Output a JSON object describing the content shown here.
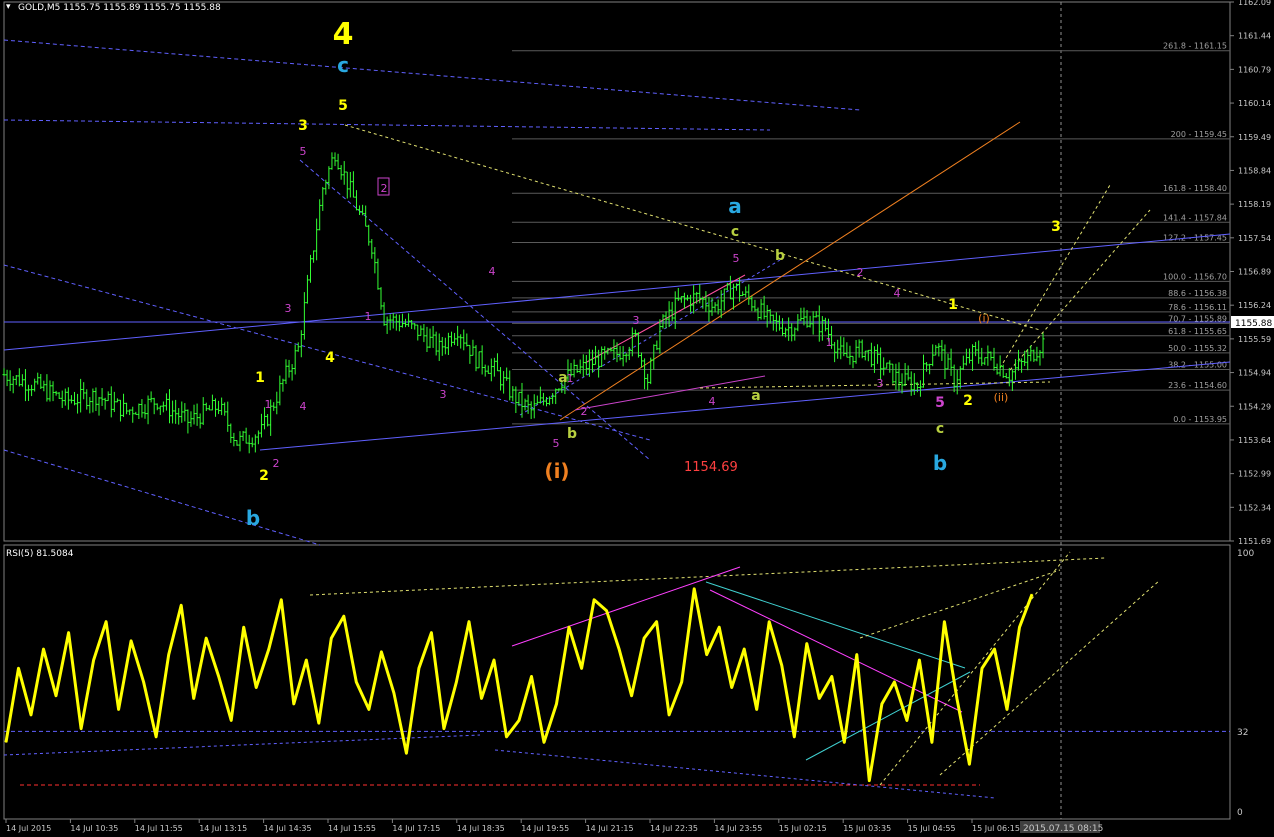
{
  "colors": {
    "background": "#000000",
    "candle": "#33ff33",
    "rsi_line": "#ffff00",
    "axis_text": "#c8c8c8",
    "fib_line": "#5a5a5a",
    "wave_yellow": "#ffff00",
    "wave_cyan": "#29a8e0",
    "wave_magenta": "#cc44cc",
    "wave_green": "#b8d040",
    "wave_orange": "#f08020",
    "trend_blue": "#6060ff",
    "red_level": "#ff3030"
  },
  "main_panel": {
    "header": "GOLD,M5  1155.75 1155.89 1155.75 1155.88",
    "current_price": "1155.88",
    "annotation_price": "1154.69"
  },
  "rsi_panel": {
    "header": "RSI(5) 81.5084",
    "levels": [
      "100",
      "32",
      "0"
    ]
  },
  "time_badge": "2015.07.15 08:15",
  "chart_data": [
    {
      "type": "candlestick",
      "title": "GOLD,M5",
      "ylim": [
        1151.69,
        1162.09
      ],
      "y_ticks": [
        "1162.09",
        "1161.44",
        "1160.79",
        "1160.14",
        "1159.49",
        "1158.84",
        "1158.19",
        "1157.54",
        "1156.89",
        "1156.24",
        "1155.59",
        "1154.94",
        "1154.29",
        "1153.64",
        "1152.99",
        "1152.34",
        "1151.69"
      ],
      "x_ticks": [
        "14 Jul 2015",
        "14 Jul 10:35",
        "14 Jul 11:55",
        "14 Jul 13:15",
        "14 Jul 14:35",
        "14 Jul 15:55",
        "14 Jul 17:15",
        "14 Jul 18:35",
        "14 Jul 19:55",
        "14 Jul 21:15",
        "14 Jul 22:35",
        "14 Jul 23:55",
        "15 Jul 02:15",
        "15 Jul 03:35",
        "15 Jul 04:55",
        "15 Jul 06:15"
      ],
      "close_path": [
        [
          0,
          1154.9
        ],
        [
          5,
          1154.7
        ],
        [
          10,
          1154.4
        ],
        [
          15,
          1154.5
        ],
        [
          20,
          1154.2
        ],
        [
          25,
          1154.4
        ],
        [
          30,
          1154.0
        ],
        [
          35,
          1154.3
        ],
        [
          38,
          1153.6
        ],
        [
          42,
          1153.8
        ],
        [
          46,
          1154.9
        ],
        [
          48,
          1155.4
        ],
        [
          50,
          1157.0
        ],
        [
          52,
          1158.5
        ],
        [
          54,
          1159.2
        ],
        [
          56,
          1158.6
        ],
        [
          58,
          1158.0
        ],
        [
          60,
          1157.4
        ],
        [
          62,
          1156.0
        ],
        [
          65,
          1155.9
        ],
        [
          68,
          1155.7
        ],
        [
          71,
          1155.4
        ],
        [
          74,
          1155.8
        ],
        [
          77,
          1155.2
        ],
        [
          80,
          1155.0
        ],
        [
          83,
          1154.5
        ],
        [
          86,
          1154.2
        ],
        [
          88,
          1154.4
        ],
        [
          91,
          1154.8
        ],
        [
          94,
          1155.0
        ],
        [
          97,
          1155.2
        ],
        [
          100,
          1155.3
        ],
        [
          103,
          1155.6
        ],
        [
          105,
          1154.8
        ],
        [
          107,
          1155.8
        ],
        [
          110,
          1156.3
        ],
        [
          113,
          1156.4
        ],
        [
          116,
          1156.2
        ],
        [
          119,
          1156.6
        ],
        [
          122,
          1156.3
        ],
        [
          125,
          1155.9
        ],
        [
          128,
          1155.8
        ],
        [
          131,
          1156.0
        ],
        [
          134,
          1155.8
        ],
        [
          137,
          1155.2
        ],
        [
          140,
          1155.4
        ],
        [
          143,
          1155.1
        ],
        [
          146,
          1154.8
        ],
        [
          149,
          1154.7
        ],
        [
          152,
          1155.5
        ],
        [
          155,
          1154.8
        ],
        [
          158,
          1155.3
        ],
        [
          161,
          1155.2
        ],
        [
          164,
          1154.9
        ],
        [
          167,
          1155.2
        ],
        [
          170,
          1155.6
        ]
      ],
      "fibonacci_levels": [
        {
          "label": "261.8 - 1161.15",
          "value": 1161.15
        },
        {
          "label": "200 - 1159.45",
          "value": 1159.45
        },
        {
          "label": "161.8 - 1158.40",
          "value": 1158.4
        },
        {
          "label": "141.4 - 1157.84",
          "value": 1157.84
        },
        {
          "label": "127.2 - 1157.45",
          "value": 1157.45
        },
        {
          "label": "100.0 - 1156.70",
          "value": 1156.7
        },
        {
          "label": "88.6 - 1156.38",
          "value": 1156.38
        },
        {
          "label": "78.6 - 1156.11",
          "value": 1156.11
        },
        {
          "label": "70.7 - 1155.89",
          "value": 1155.89
        },
        {
          "label": "61.8 - 1155.65",
          "value": 1155.65
        },
        {
          "label": "50.0 - 1155.32",
          "value": 1155.32
        },
        {
          "label": "38.2 - 1155.00",
          "value": 1155.0
        },
        {
          "label": "23.6 - 1154.60",
          "value": 1154.6
        },
        {
          "label": "0.0 - 1153.95",
          "value": 1153.95
        }
      ],
      "wave_labels": [
        {
          "text": "4",
          "color": "wave_yellow",
          "size": "xl"
        },
        {
          "text": "c",
          "color": "wave_cyan",
          "size": "lg"
        },
        {
          "text": "5",
          "color": "wave_yellow",
          "size": "md"
        },
        {
          "text": "3",
          "color": "wave_yellow",
          "size": "md"
        },
        {
          "text": "5",
          "color": "wave_magenta",
          "size": "sm"
        },
        {
          "text": "2",
          "color": "wave_magenta",
          "size": "sm"
        },
        {
          "text": "4",
          "color": "wave_magenta",
          "size": "sm"
        },
        {
          "text": "3",
          "color": "wave_magenta",
          "size": "sm"
        },
        {
          "text": "1",
          "color": "wave_magenta",
          "size": "sm"
        },
        {
          "text": "4",
          "color": "wave_yellow",
          "size": "md"
        },
        {
          "text": "3",
          "color": "wave_magenta",
          "size": "sm"
        },
        {
          "text": "1",
          "color": "wave_yellow",
          "size": "md"
        },
        {
          "text": "1",
          "color": "wave_magenta",
          "size": "sm"
        },
        {
          "text": "4",
          "color": "wave_magenta",
          "size": "sm"
        },
        {
          "text": "2",
          "color": "wave_yellow",
          "size": "md"
        },
        {
          "text": "2",
          "color": "wave_magenta",
          "size": "sm"
        },
        {
          "text": "b",
          "color": "wave_cyan",
          "size": "lg"
        },
        {
          "text": "a",
          "color": "wave_green",
          "size": "md"
        },
        {
          "text": "1",
          "color": "wave_magenta",
          "size": "sm"
        },
        {
          "text": "5",
          "color": "wave_magenta",
          "size": "sm"
        },
        {
          "text": "b",
          "color": "wave_green",
          "size": "md"
        },
        {
          "text": "2",
          "color": "wave_magenta",
          "size": "sm"
        },
        {
          "text": "(i)",
          "color": "wave_orange",
          "size": "lg"
        },
        {
          "text": "3",
          "color": "wave_magenta",
          "size": "sm"
        },
        {
          "text": "4",
          "color": "wave_magenta",
          "size": "sm"
        },
        {
          "text": "a",
          "color": "wave_cyan",
          "size": "lg"
        },
        {
          "text": "c",
          "color": "wave_green",
          "size": "md"
        },
        {
          "text": "5",
          "color": "wave_magenta",
          "size": "sm"
        },
        {
          "text": "b",
          "color": "wave_green",
          "size": "md"
        },
        {
          "text": "a",
          "color": "wave_green",
          "size": "md"
        },
        {
          "text": "2",
          "color": "wave_magenta",
          "size": "sm"
        },
        {
          "text": "1",
          "color": "wave_magenta",
          "size": "sm"
        },
        {
          "text": "4",
          "color": "wave_magenta",
          "size": "sm"
        },
        {
          "text": "3",
          "color": "wave_magenta",
          "size": "sm"
        },
        {
          "text": "1",
          "color": "wave_yellow",
          "size": "md"
        },
        {
          "text": "(i)",
          "color": "wave_orange",
          "size": "sm"
        },
        {
          "text": "5",
          "color": "wave_magenta",
          "size": "md"
        },
        {
          "text": "2",
          "color": "wave_yellow",
          "size": "md"
        },
        {
          "text": "(ii)",
          "color": "wave_orange",
          "size": "sm"
        },
        {
          "text": "c",
          "color": "wave_green",
          "size": "md"
        },
        {
          "text": "b",
          "color": "wave_cyan",
          "size": "lg"
        },
        {
          "text": "3",
          "color": "wave_yellow",
          "size": "md"
        }
      ]
    },
    {
      "type": "line",
      "title": "RSI(5) 81.5084",
      "ylim": [
        0,
        100
      ],
      "levels": [
        32
      ],
      "series": [
        {
          "values": [
            28,
            55,
            38,
            62,
            45,
            68,
            33,
            58,
            72,
            40,
            65,
            50,
            30,
            60,
            78,
            44,
            66,
            52,
            36,
            70,
            48,
            62,
            80,
            42,
            58,
            35,
            66,
            74,
            50,
            40,
            61,
            46,
            24,
            55,
            68,
            33,
            50,
            72,
            44,
            58,
            30,
            36,
            52,
            28,
            42,
            70,
            55,
            80,
            76,
            62,
            45,
            66,
            72,
            38,
            50,
            84,
            60,
            70,
            48,
            62,
            40,
            72,
            56,
            30,
            64,
            44,
            52,
            28,
            60,
            14,
            42,
            50,
            36,
            58,
            28,
            72,
            44,
            20,
            55,
            62,
            40,
            70,
            82
          ]
        }
      ],
      "current": 81.5084
    }
  ]
}
